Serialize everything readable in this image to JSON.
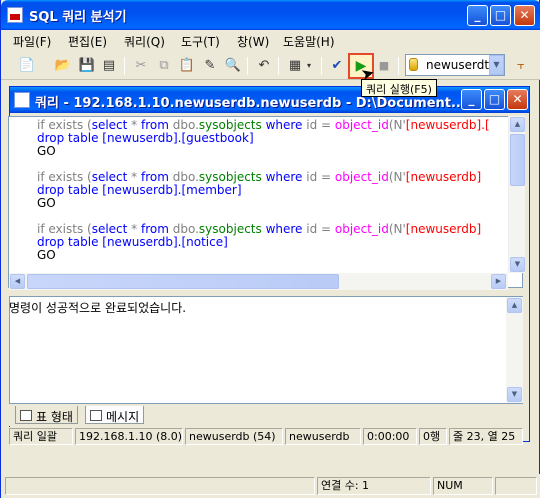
{
  "app": {
    "title": "SQL 쿼리 분석기"
  },
  "menu": [
    "파일(F)",
    "편집(E)",
    "쿼리(Q)",
    "도구(T)",
    "창(W)",
    "도움말(H)"
  ],
  "toolbar": {
    "db_select": "newuserdt",
    "tooltip": "쿼리 실행(F5)"
  },
  "child": {
    "title": "쿼리 - 192.168.1.10.newuserdb.newuserdb - D:\\Document..."
  },
  "editor": {
    "lines": [
      [
        "if exists (",
        "select",
        " * ",
        "from",
        " dbo.",
        "sysobjects",
        " ",
        "where",
        " id = ",
        "object_id",
        "(N'",
        "[newuserdb].[",
        ""
      ],
      "drop table [newuserdb].[guestbook]",
      "GO"
    ]
  },
  "code": {
    "l1a": "if exists (",
    "l1b": "select",
    "l1c": " * ",
    "l1d": "from",
    "l1e": " dbo.",
    "l1f": "sysobjects",
    "l1g": " where",
    "l1h": " id = ",
    "l1i": "object_id",
    "l1j": "(N'",
    "l1k": "[newuserdb].[",
    "l2": "drop table [newuserdb].[guestbook]",
    "l3": "GO",
    "l5a": "if exists (",
    "l5b": "select",
    "l5c": " * ",
    "l5d": "from",
    "l5e": " dbo.",
    "l5f": "sysobjects",
    "l5g": " where",
    "l5h": " id = ",
    "l5i": "object_id",
    "l5j": "(N'",
    "l5k": "[newuserdb]",
    "l6": "drop table [newuserdb].[member]",
    "l7": "GO",
    "l9a": "if exists (",
    "l9b": "select",
    "l9c": " * ",
    "l9d": "from",
    "l9e": " dbo.",
    "l9f": "sysobjects",
    "l9g": " where",
    "l9h": " id = ",
    "l9i": "object_id",
    "l9j": "(N'",
    "l9k": "[newuserdb]",
    "l10": "drop table [newuserdb].[notice]",
    "l11": "GO"
  },
  "results": {
    "message": "명령이 성공적으로 완료되었습니다."
  },
  "result_tabs": [
    "표 형태",
    "메시지"
  ],
  "status_inner": [
    "쿼리 일괄",
    "192.168.1.10 (8.0)",
    "newuserdb (54)",
    "newuserdb",
    "0:00:00",
    "0행",
    "줄 23, 열 25"
  ],
  "status_main": {
    "connections": "연결 수: 1",
    "num": "NUM"
  }
}
